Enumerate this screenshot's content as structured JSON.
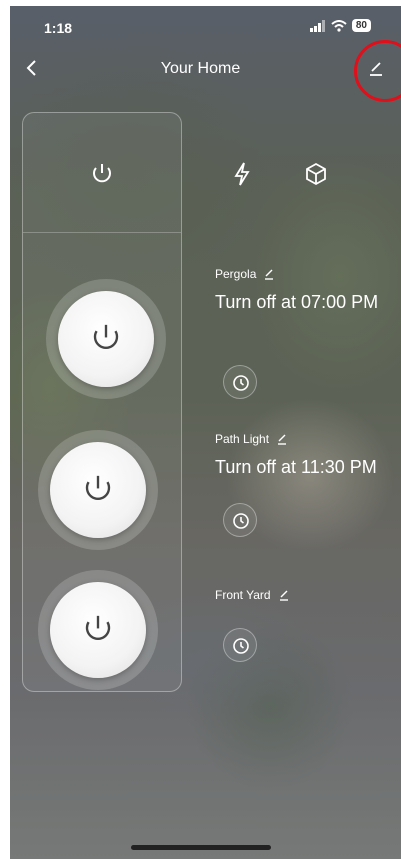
{
  "status": {
    "time": "1:18",
    "battery": "80"
  },
  "header": {
    "title": "Your Home"
  },
  "zones": [
    {
      "name": "Pergola",
      "schedule": "Turn off at 07:00 PM"
    },
    {
      "name": "Path Light",
      "schedule": "Turn off at 11:30 PM"
    },
    {
      "name": "Front Yard",
      "schedule": ""
    }
  ],
  "colors": {
    "highlight_ring": "#e00f1a",
    "text": "#ffffff"
  },
  "icons": [
    "back-icon",
    "edit-icon",
    "power-icon",
    "lightning-icon",
    "cube-icon",
    "clock-icon"
  ]
}
